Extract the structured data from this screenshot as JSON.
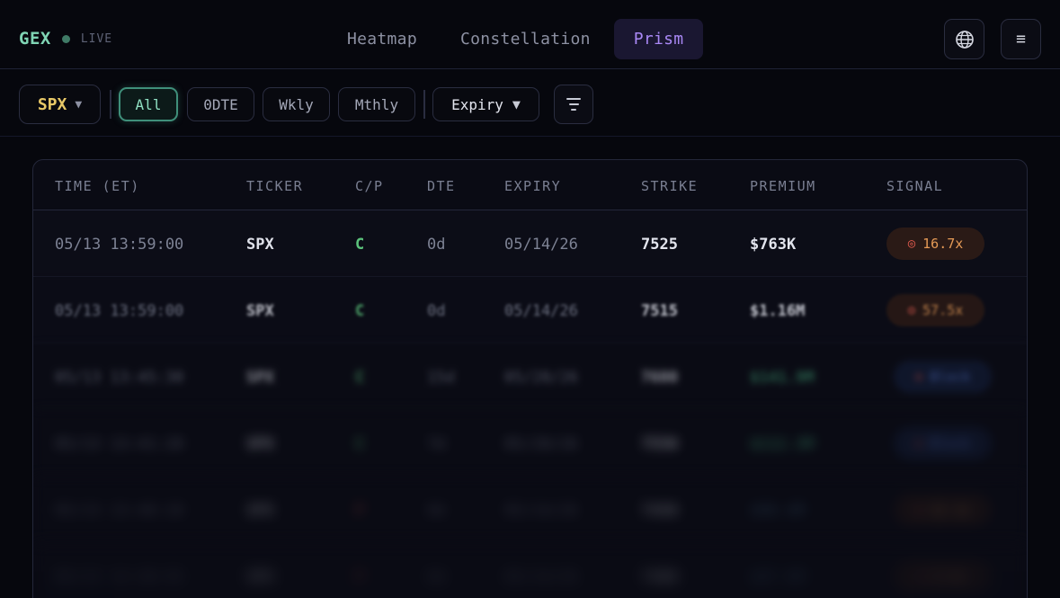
{
  "brand": {
    "logo": "GEX",
    "status": "LIVE"
  },
  "nav": {
    "tabs": [
      "Heatmap",
      "Constellation",
      "Prism"
    ],
    "active": "Prism"
  },
  "header_icons": [
    "globe-icon",
    "hamburger-menu-icon"
  ],
  "filters": {
    "ticker": "SPX",
    "ranges": [
      "All",
      "0DTE",
      "Wkly",
      "Mthly"
    ],
    "active_range": "All",
    "expiry_label": "Expiry"
  },
  "table": {
    "columns": [
      "TIME (ET)",
      "TICKER",
      "C/P",
      "DTE",
      "EXPIRY",
      "STRIKE",
      "PREMIUM",
      "SIGNAL"
    ],
    "rows": [
      {
        "time": "05/13 13:59:00",
        "ticker": "SPX",
        "cp": "C",
        "dte": "0d",
        "expiry": "05/14/26",
        "strike": "7525",
        "premium": "$763K",
        "signal": "16.7x"
      },
      {
        "time": "05/13 13:59:00",
        "ticker": "SPX",
        "cp": "C",
        "dte": "0d",
        "expiry": "05/14/26",
        "strike": "7515",
        "premium": "$1.16M",
        "signal": "57.5x"
      },
      {
        "time": "05/13 13:45:30",
        "ticker": "SPX",
        "cp": "C",
        "dte": "15d",
        "expiry": "05/28/26",
        "strike": "7600",
        "premium": "$141.9M",
        "signal": "Block"
      },
      {
        "time": "05/13 13:41:20",
        "ticker": "SPX",
        "cp": "C",
        "dte": "7d",
        "expiry": "05/20/26",
        "strike": "7550",
        "premium": "$112.3M",
        "signal": "Block"
      },
      {
        "time": "05/13 13:40:10",
        "ticker": "SPX",
        "cp": "P",
        "dte": "0d",
        "expiry": "05/14/26",
        "strike": "7450",
        "premium": "$98.4M",
        "signal": "12.1x"
      },
      {
        "time": "05/13 13:38:55",
        "ticker": "SPX",
        "cp": "P",
        "dte": "0d",
        "expiry": "05/14/26",
        "strike": "7400",
        "premium": "$87.6M",
        "signal": "9.8x"
      }
    ]
  },
  "colors": {
    "brand": "#7fd4b4",
    "ticker": "#e8c867",
    "active_tab": "#a988f5",
    "active_filter": "#3f8f7a",
    "call": "#5bc27b",
    "signal": "#e59a56"
  }
}
